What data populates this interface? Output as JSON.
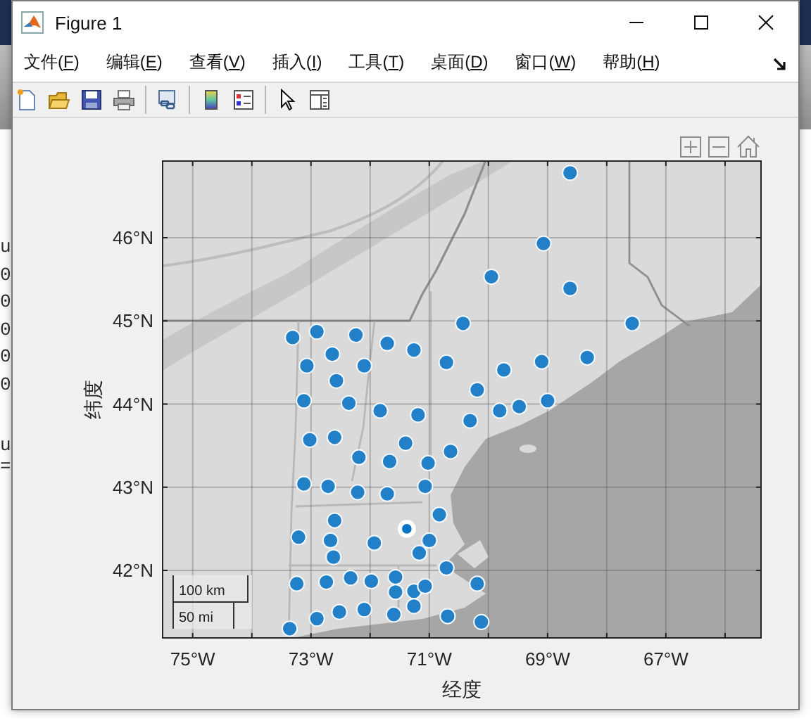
{
  "background": {
    "left_text_1": [
      "u",
      "0",
      "0",
      "0",
      "0",
      "0"
    ],
    "left_text_2": [
      "u",
      "="
    ]
  },
  "window": {
    "title": "Figure 1"
  },
  "menu": [
    "文件(F)",
    "编辑(E)",
    "查看(V)",
    "插入(I)",
    "工具(T)",
    "桌面(D)",
    "窗口(W)",
    "帮助(H)"
  ],
  "axes": {
    "chart_data": {
      "type": "scatter",
      "xlabel": "经度",
      "ylabel": "纬度",
      "grid": true,
      "xlim": [
        -75.52,
        -65.38
      ],
      "ylim": [
        41.18,
        46.93
      ],
      "xticks": [
        {
          "value": -75,
          "label": "75°W"
        },
        {
          "value": -73,
          "label": "73°W"
        },
        {
          "value": -71,
          "label": "71°W"
        },
        {
          "value": -69,
          "label": "69°W"
        },
        {
          "value": -67,
          "label": "67°W"
        }
      ],
      "yticks": [
        {
          "value": 42,
          "label": "42°N"
        },
        {
          "value": 43,
          "label": "43°N"
        },
        {
          "value": 44,
          "label": "44°N"
        },
        {
          "value": 45,
          "label": "45°N"
        },
        {
          "value": 46,
          "label": "46°N"
        }
      ],
      "x": [
        -68.62,
        -69.07,
        -69.95,
        -68.62,
        -70.43,
        -67.57,
        -73.31,
        -72.9,
        -72.24,
        -71.71,
        -71.26,
        -72.64,
        -73.07,
        -72.1,
        -70.71,
        -69.74,
        -69.1,
        -68.33,
        -72.57,
        -70.19,
        -73.12,
        -72.36,
        -71.83,
        -71.19,
        -70.31,
        -69.81,
        -69.48,
        -69.0,
        -73.02,
        -72.6,
        -71.4,
        -70.64,
        -72.19,
        -71.67,
        -71.02,
        -73.12,
        -72.71,
        -72.21,
        -71.71,
        -71.07,
        -70.83,
        -72.6,
        -73.21,
        -72.67,
        -71.93,
        -71.0,
        -71.17,
        -72.62,
        -71.38,
        -70.71,
        -73.24,
        -72.74,
        -72.33,
        -71.98,
        -71.57,
        -71.57,
        -71.26,
        -71.07,
        -70.19,
        -72.9,
        -72.52,
        -72.1,
        -71.6,
        -71.26,
        -70.69,
        -70.12,
        -73.36
      ],
      "series": [
        {
          "color": "#2180c8",
          "values": [
            46.78,
            45.93,
            45.53,
            45.39,
            44.97,
            44.97,
            44.8,
            44.87,
            44.83,
            44.73,
            44.65,
            44.6,
            44.46,
            44.46,
            44.5,
            44.41,
            44.51,
            44.56,
            44.28,
            44.17,
            44.04,
            44.01,
            43.92,
            43.87,
            43.8,
            43.92,
            43.97,
            44.04,
            43.57,
            43.6,
            43.53,
            43.43,
            43.36,
            43.31,
            43.29,
            43.04,
            43.01,
            42.94,
            42.92,
            43.01,
            42.67,
            42.6,
            42.4,
            42.36,
            42.33,
            42.36,
            42.21,
            42.16,
            null,
            42.03,
            41.84,
            41.86,
            41.91,
            41.87,
            41.92,
            41.74,
            41.75,
            41.81,
            41.84,
            41.42,
            41.5,
            41.53,
            41.47,
            41.57,
            41.45,
            41.38,
            41.3
          ]
        },
        {
          "color": "#0b72c4",
          "values": [
            null,
            null,
            null,
            null,
            null,
            null,
            null,
            null,
            null,
            null,
            null,
            null,
            null,
            null,
            null,
            null,
            null,
            null,
            null,
            null,
            null,
            null,
            null,
            null,
            null,
            null,
            null,
            null,
            null,
            null,
            null,
            null,
            null,
            null,
            null,
            null,
            null,
            null,
            null,
            null,
            null,
            null,
            null,
            null,
            null,
            null,
            null,
            null,
            42.5,
            null,
            null,
            null,
            null,
            null,
            null,
            null,
            null,
            null,
            null,
            null,
            null,
            null,
            null,
            null,
            null,
            null,
            null
          ]
        }
      ]
    },
    "scale_bar": [
      "100 km",
      "50 mi"
    ]
  }
}
